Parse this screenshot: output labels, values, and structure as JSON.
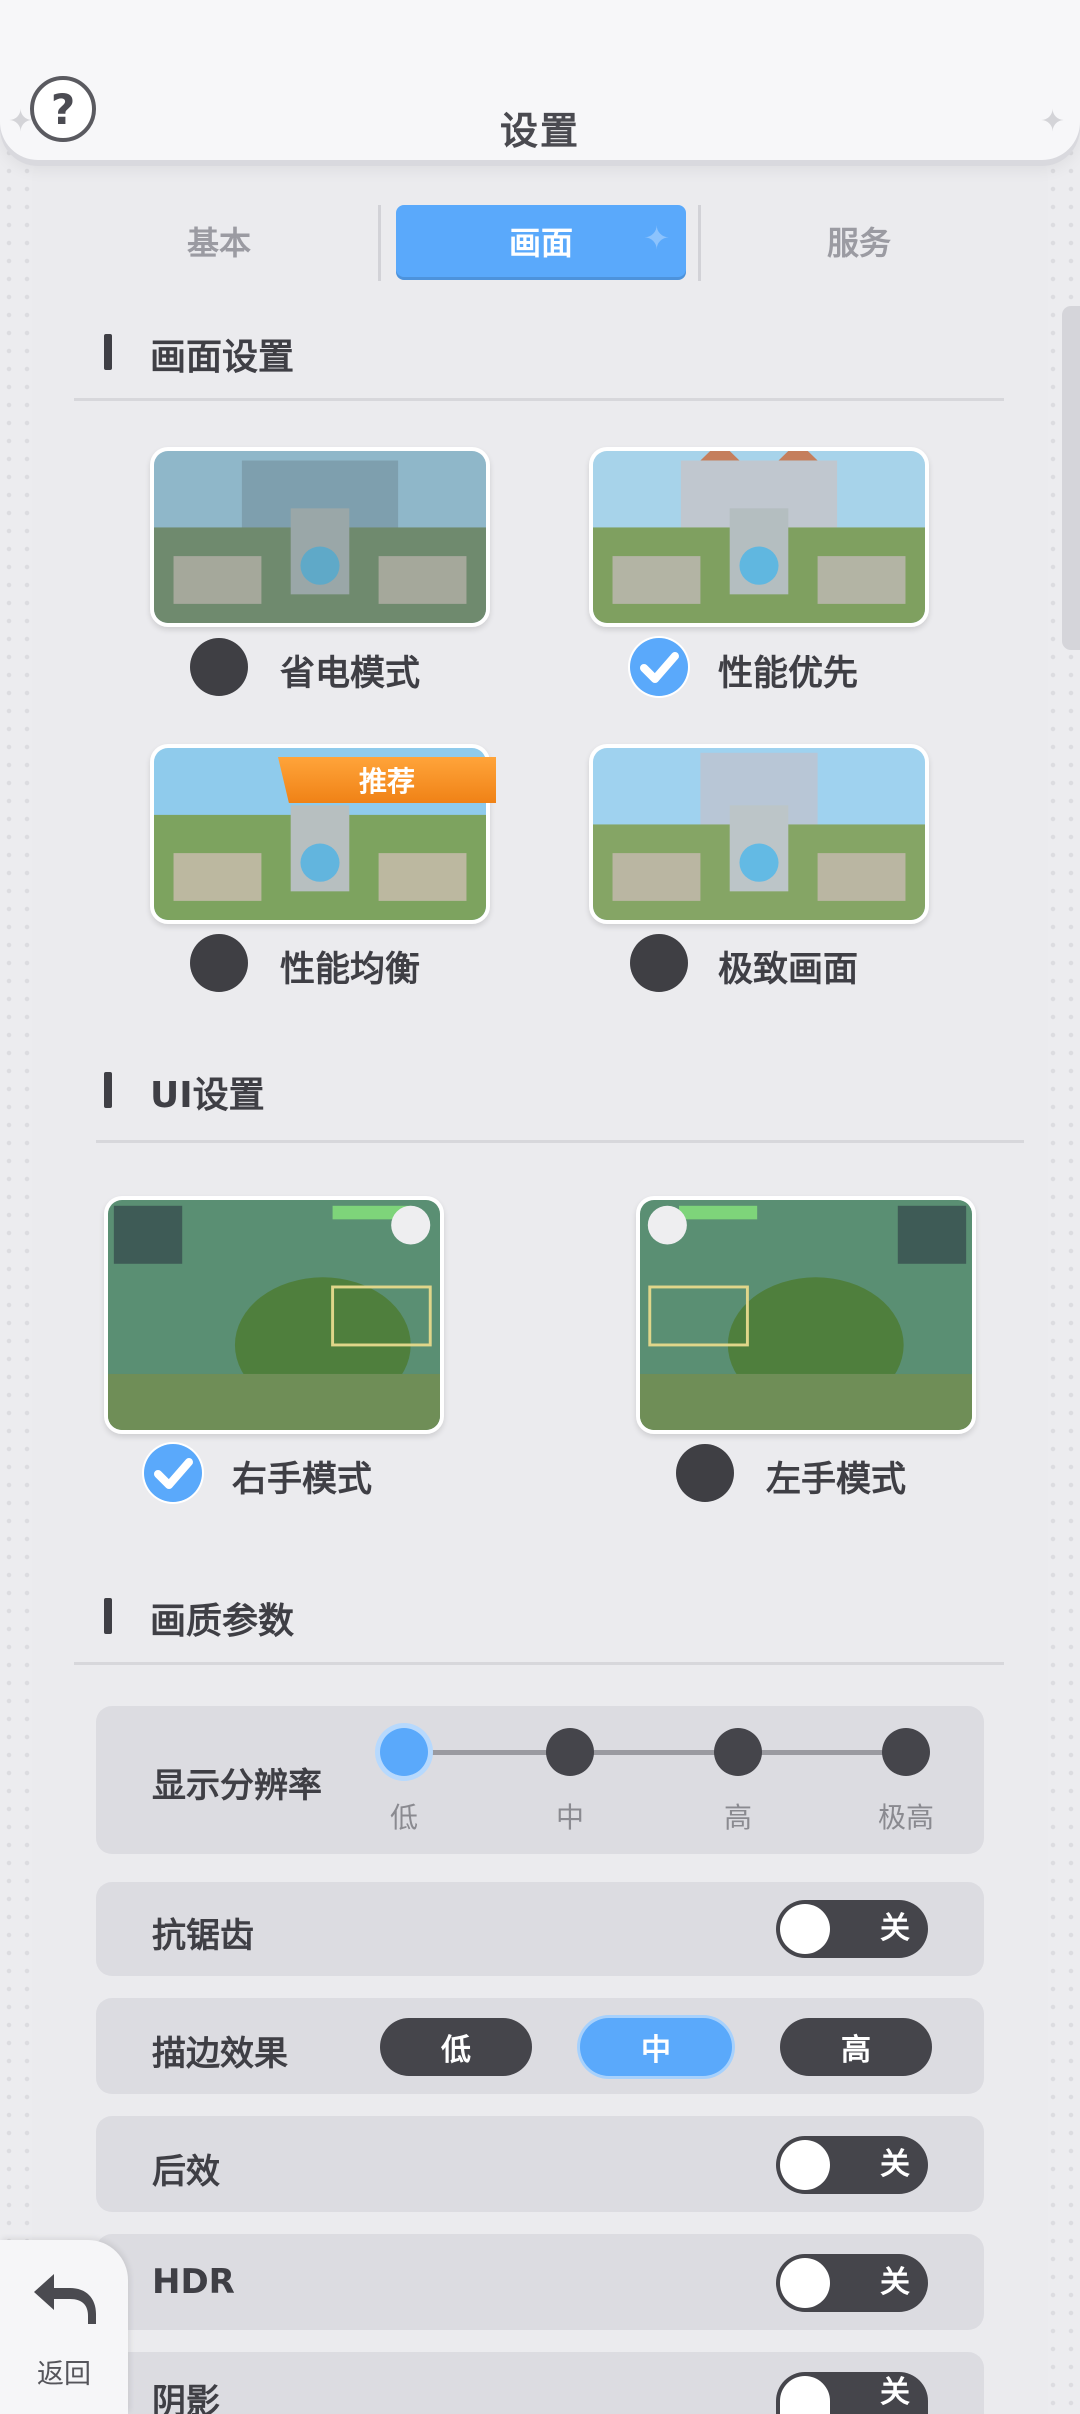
{
  "header": {
    "title": "设置",
    "help_label": "?"
  },
  "tabs": [
    {
      "label": "基本",
      "active": false
    },
    {
      "label": "画面",
      "active": true
    },
    {
      "label": "服务",
      "active": false
    }
  ],
  "graphics_section": {
    "title": "画面设置",
    "options": [
      {
        "label": "省电模式",
        "selected": false
      },
      {
        "label": "性能优先",
        "selected": true
      },
      {
        "label": "性能均衡",
        "selected": false,
        "badge": "推荐"
      },
      {
        "label": "极致画面",
        "selected": false
      }
    ]
  },
  "ui_section": {
    "title": "UI设置",
    "options": [
      {
        "label": "右手模式",
        "selected": true
      },
      {
        "label": "左手模式",
        "selected": false
      }
    ]
  },
  "quality_section": {
    "title": "画质参数",
    "resolution": {
      "label": "显示分辨率",
      "levels": [
        "低",
        "中",
        "高",
        "极高"
      ],
      "selected": "低"
    },
    "antialias": {
      "label": "抗锯齿",
      "state": "关"
    },
    "outline": {
      "label": "描边效果",
      "levels": [
        "低",
        "中",
        "高"
      ],
      "selected": "中"
    },
    "post_effect": {
      "label": "后效",
      "state": "关"
    },
    "hdr": {
      "label": "HDR",
      "state": "关"
    },
    "shadow": {
      "label": "阴影",
      "state": "关"
    }
  },
  "back_button": {
    "label": "返回"
  },
  "colors": {
    "accent": "#5aa9fb",
    "dark": "#45454b",
    "badge": "#f08216"
  }
}
